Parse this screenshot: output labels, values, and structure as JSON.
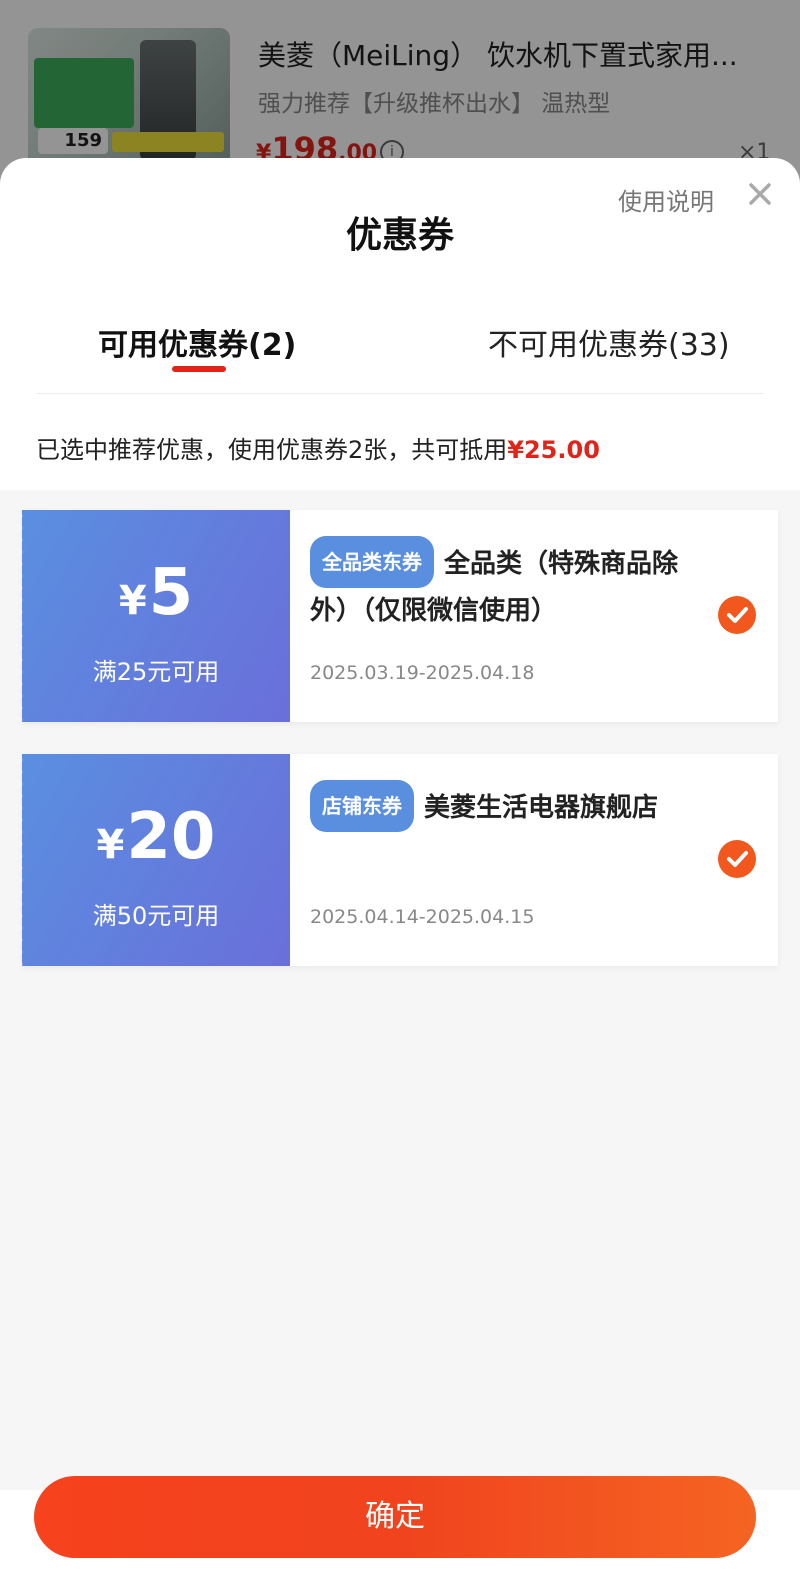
{
  "product": {
    "title": "美菱（MeiLing） 饮水机下置式家用...",
    "subtitle": "强力推荐【升级推杯出水】 温热型",
    "price_currency": "¥",
    "price_int": "198",
    "price_dec": ".00",
    "thumb_price": "159",
    "quantity": "×1"
  },
  "sheet": {
    "title": "优惠券",
    "help_label": "使用说明"
  },
  "tabs": [
    {
      "label": "可用优惠券(2)"
    },
    {
      "label": "不可用优惠券(33)"
    }
  ],
  "summary": {
    "text": "已选中推荐优惠，使用优惠券2张，共可抵用",
    "amount": "¥25.00"
  },
  "coupons": [
    {
      "currency": "¥",
      "value": "5",
      "condition": "满25元可用",
      "badge": "全品类东券",
      "title": "全品类（特殊商品除外）（仅限微信使用）",
      "date": "2025.03.19-2025.04.18"
    },
    {
      "currency": "¥",
      "value": "20",
      "condition": "满50元可用",
      "badge": "店铺东券",
      "title": "美菱生活电器旗舰店",
      "date": "2025.04.14-2025.04.15"
    }
  ],
  "confirm_label": "确定",
  "colors": {
    "accent_red": "#e2231a",
    "coupon_blue": "#5a8fe0",
    "check_orange": "#f2581e"
  }
}
